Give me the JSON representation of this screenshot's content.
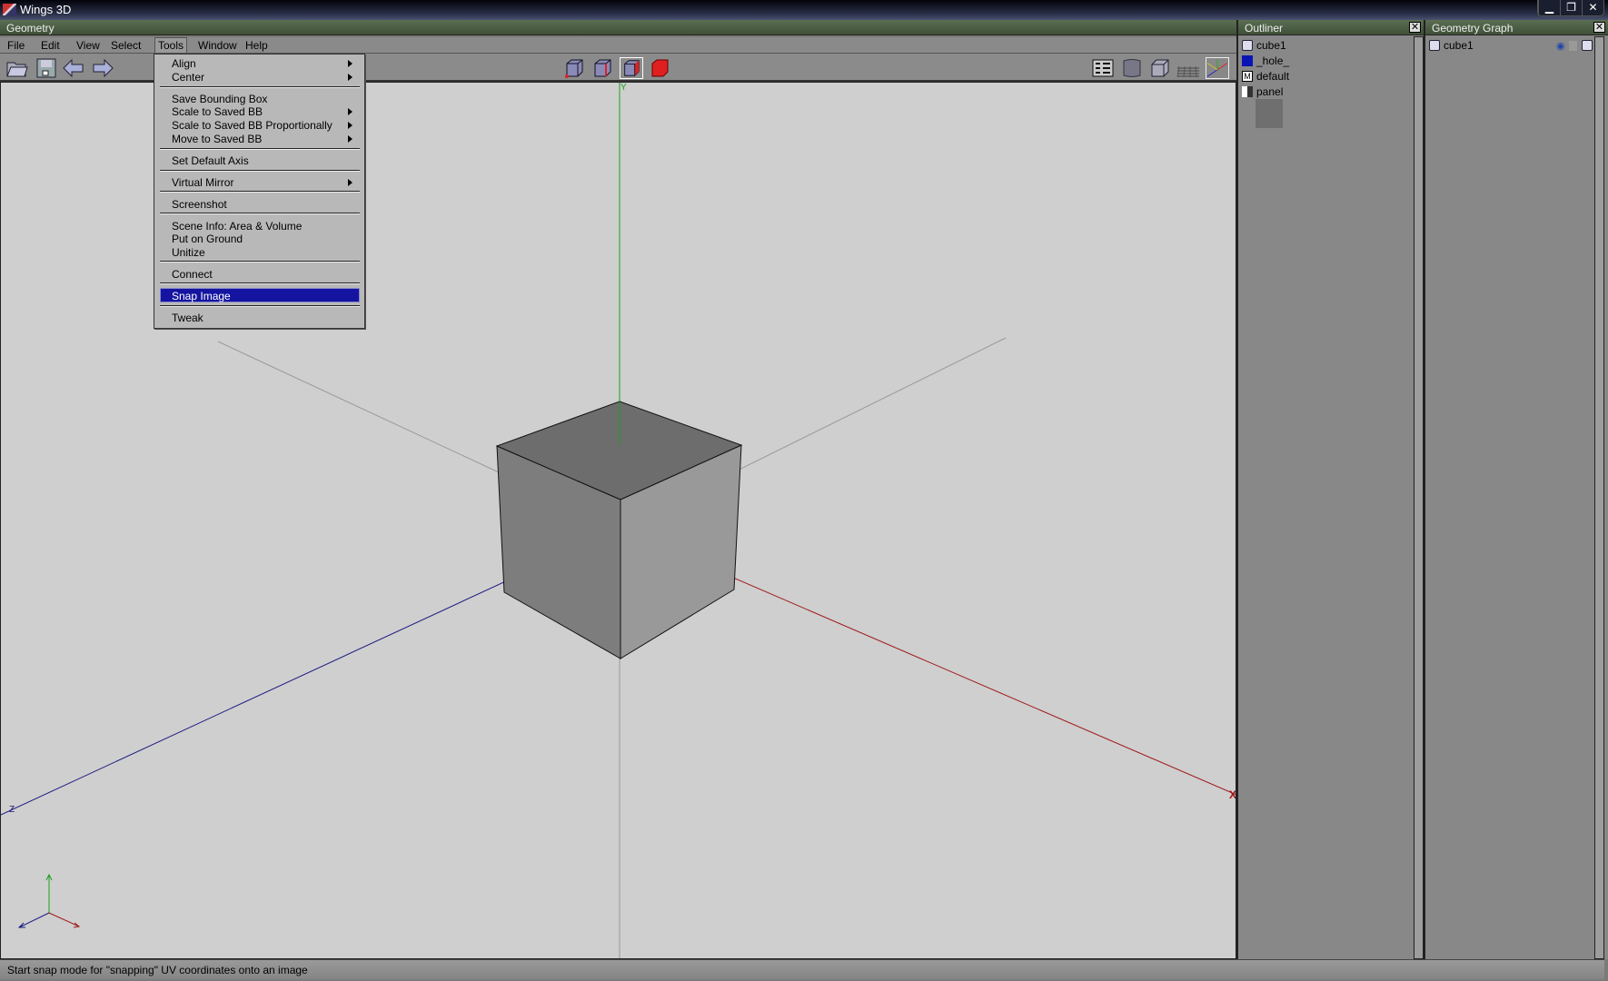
{
  "window": {
    "title": "Wings 3D",
    "controls": [
      "minimize",
      "restore",
      "close"
    ]
  },
  "geometry": {
    "title": "Geometry"
  },
  "menubar": [
    "File",
    "Edit",
    "View",
    "Select",
    "Tools",
    "Window",
    "Help"
  ],
  "tools_menu": {
    "items": [
      {
        "label": "Align",
        "submenu": true
      },
      {
        "label": "Center",
        "submenu": true
      },
      {
        "label": "Save Bounding Box",
        "submenu": false
      },
      {
        "label": "Scale to Saved BB",
        "submenu": true
      },
      {
        "label": "Scale to Saved BB Proportionally",
        "submenu": true
      },
      {
        "label": "Move to Saved BB",
        "submenu": true
      },
      {
        "label": "Set Default Axis",
        "submenu": false
      },
      {
        "label": "Virtual Mirror",
        "submenu": true
      },
      {
        "label": "Screenshot",
        "submenu": false
      },
      {
        "label": "Scene Info: Area & Volume",
        "submenu": false
      },
      {
        "label": "Put on Ground",
        "submenu": false
      },
      {
        "label": "Unitize",
        "submenu": false
      },
      {
        "label": "Connect",
        "submenu": false
      },
      {
        "label": "Snap Image",
        "submenu": false,
        "highlighted": true
      },
      {
        "label": "Tweak",
        "submenu": false
      }
    ]
  },
  "toolbar": {
    "left": [
      "open-icon",
      "save-icon",
      "undo-icon",
      "redo-icon"
    ],
    "center": [
      "vertex-mode-icon",
      "edge-mode-icon",
      "face-mode-icon",
      "body-mode-icon"
    ],
    "right": [
      "view-options-icon",
      "smooth-shade-icon",
      "wireframe-icon",
      "ground-grid-icon",
      "axes-icon"
    ]
  },
  "viewport": {
    "axis_labels": {
      "x": "X",
      "y": "Y",
      "z": "Z"
    },
    "colors": {
      "x": "#a01818",
      "y": "#1ea01e",
      "z": "#1a1a80"
    }
  },
  "outliner": {
    "title": "Outliner",
    "items": [
      {
        "label": "cube1",
        "icon": "cube-icon"
      },
      {
        "label": "_hole_",
        "icon": "material-blue-icon",
        "color": "#0a14b4"
      },
      {
        "label": "default",
        "icon": "material-icon"
      },
      {
        "label": "panel",
        "icon": "image-icon"
      }
    ]
  },
  "geometry_graph": {
    "title": "Geometry Graph",
    "items": [
      {
        "label": "cube1"
      }
    ]
  },
  "status": "Start snap mode for \"snapping\" UV coordinates onto an image"
}
